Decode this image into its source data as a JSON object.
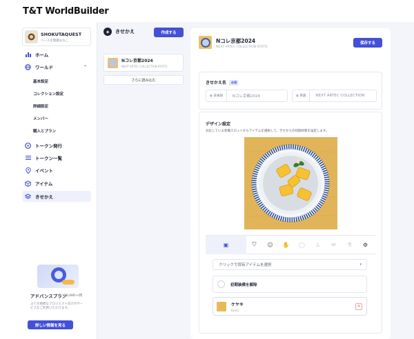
{
  "brand": {
    "logo": "T&T WorldBuilder"
  },
  "project": {
    "name": "SHOKUTAQUEST",
    "subtitle": "ベースを無題まなこ"
  },
  "sidebar": {
    "items": [
      {
        "label": "ホーム",
        "icon": "chart-icon"
      },
      {
        "label": "ワールド",
        "icon": "globe-icon"
      },
      {
        "label": "トークン発行",
        "icon": "token-icon"
      },
      {
        "label": "トークン一覧",
        "icon": "list-icon"
      },
      {
        "label": "イベント",
        "icon": "pin-icon"
      },
      {
        "label": "アイテム",
        "icon": "box-icon"
      },
      {
        "label": "きせかえ",
        "icon": "layers-icon"
      }
    ],
    "world_sub": [
      "基本設定",
      "コレクション設定",
      "詳細設定",
      "メンバー",
      "購入とプラン"
    ],
    "plan": {
      "title": "アドバンスプラン",
      "price": "¥6,000〜/月",
      "desc": "より大規模なプロジェクト向けのサービスをご利用いただけます。",
      "button": "詳しい情報を見る"
    }
  },
  "skins": {
    "title": "きせかえ",
    "create": "作成する",
    "list": [
      {
        "name": "Nコレ京都2024",
        "sub": "NEXT ARTEC COLLECTION KYOTO"
      }
    ],
    "more": "さらに読み込む"
  },
  "editor": {
    "title": "Nコレ京都2024",
    "subtitle": "NEXT ARTEC COLLECTION KYOTO",
    "save": "保存する",
    "name_label": "きせかえ名",
    "required": "必須",
    "name_ja_tag": "日本語",
    "name_ja": "Nコレ京都2024",
    "name_en_tag": "英語",
    "name_en": "NEXT ARTEC COLLECTION",
    "design_title": "デザイン設定",
    "design_desc": "対応している装備スロットからアイテムを選択して、きせかえの初期状態を設定します。",
    "select_placeholder": "クリックで保有アイテムを選択",
    "reset": "初期装備を解除",
    "item": {
      "name": "ケヤキ",
      "sub": "Kyoto"
    }
  }
}
